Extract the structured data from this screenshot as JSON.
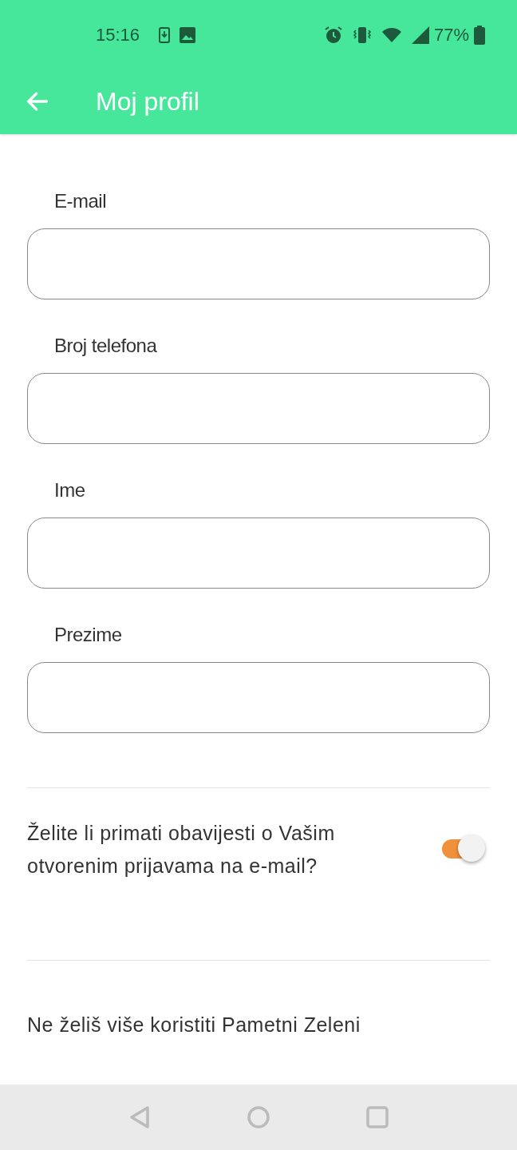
{
  "status_bar": {
    "time": "15:16",
    "battery": "77%"
  },
  "app_bar": {
    "title": "Moj profil"
  },
  "fields": [
    {
      "label": "E-mail"
    },
    {
      "label": "Broj telefona"
    },
    {
      "label": "Ime"
    },
    {
      "label": "Prezime"
    }
  ],
  "notifications": {
    "question": "Želite li primati obavijesti o Vašim otvorenim prijavama na e-mail?",
    "checked": true
  },
  "deactivate_text": "Ne želiš više koristiti Pametni Zeleni"
}
